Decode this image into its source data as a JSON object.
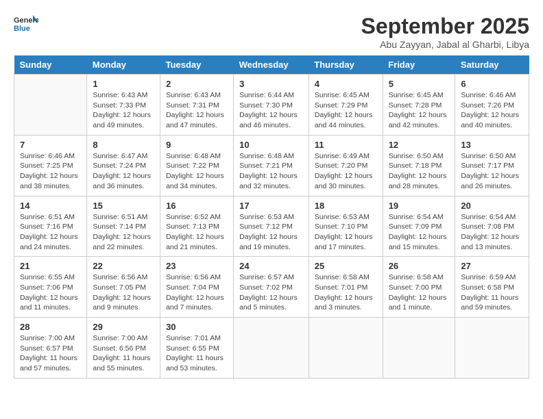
{
  "header": {
    "logo_line1": "General",
    "logo_line2": "Blue",
    "month": "September 2025",
    "location": "Abu Zayyan, Jabal al Gharbi, Libya"
  },
  "days_of_week": [
    "Sunday",
    "Monday",
    "Tuesday",
    "Wednesday",
    "Thursday",
    "Friday",
    "Saturday"
  ],
  "weeks": [
    [
      {
        "day": "",
        "info": ""
      },
      {
        "day": "1",
        "info": "Sunrise: 6:43 AM\nSunset: 7:33 PM\nDaylight: 12 hours\nand 49 minutes."
      },
      {
        "day": "2",
        "info": "Sunrise: 6:43 AM\nSunset: 7:31 PM\nDaylight: 12 hours\nand 47 minutes."
      },
      {
        "day": "3",
        "info": "Sunrise: 6:44 AM\nSunset: 7:30 PM\nDaylight: 12 hours\nand 46 minutes."
      },
      {
        "day": "4",
        "info": "Sunrise: 6:45 AM\nSunset: 7:29 PM\nDaylight: 12 hours\nand 44 minutes."
      },
      {
        "day": "5",
        "info": "Sunrise: 6:45 AM\nSunset: 7:28 PM\nDaylight: 12 hours\nand 42 minutes."
      },
      {
        "day": "6",
        "info": "Sunrise: 6:46 AM\nSunset: 7:26 PM\nDaylight: 12 hours\nand 40 minutes."
      }
    ],
    [
      {
        "day": "7",
        "info": "Sunrise: 6:46 AM\nSunset: 7:25 PM\nDaylight: 12 hours\nand 38 minutes."
      },
      {
        "day": "8",
        "info": "Sunrise: 6:47 AM\nSunset: 7:24 PM\nDaylight: 12 hours\nand 36 minutes."
      },
      {
        "day": "9",
        "info": "Sunrise: 6:48 AM\nSunset: 7:22 PM\nDaylight: 12 hours\nand 34 minutes."
      },
      {
        "day": "10",
        "info": "Sunrise: 6:48 AM\nSunset: 7:21 PM\nDaylight: 12 hours\nand 32 minutes."
      },
      {
        "day": "11",
        "info": "Sunrise: 6:49 AM\nSunset: 7:20 PM\nDaylight: 12 hours\nand 30 minutes."
      },
      {
        "day": "12",
        "info": "Sunrise: 6:50 AM\nSunset: 7:18 PM\nDaylight: 12 hours\nand 28 minutes."
      },
      {
        "day": "13",
        "info": "Sunrise: 6:50 AM\nSunset: 7:17 PM\nDaylight: 12 hours\nand 26 minutes."
      }
    ],
    [
      {
        "day": "14",
        "info": "Sunrise: 6:51 AM\nSunset: 7:16 PM\nDaylight: 12 hours\nand 24 minutes."
      },
      {
        "day": "15",
        "info": "Sunrise: 6:51 AM\nSunset: 7:14 PM\nDaylight: 12 hours\nand 22 minutes."
      },
      {
        "day": "16",
        "info": "Sunrise: 6:52 AM\nSunset: 7:13 PM\nDaylight: 12 hours\nand 21 minutes."
      },
      {
        "day": "17",
        "info": "Sunrise: 6:53 AM\nSunset: 7:12 PM\nDaylight: 12 hours\nand 19 minutes."
      },
      {
        "day": "18",
        "info": "Sunrise: 6:53 AM\nSunset: 7:10 PM\nDaylight: 12 hours\nand 17 minutes."
      },
      {
        "day": "19",
        "info": "Sunrise: 6:54 AM\nSunset: 7:09 PM\nDaylight: 12 hours\nand 15 minutes."
      },
      {
        "day": "20",
        "info": "Sunrise: 6:54 AM\nSunset: 7:08 PM\nDaylight: 12 hours\nand 13 minutes."
      }
    ],
    [
      {
        "day": "21",
        "info": "Sunrise: 6:55 AM\nSunset: 7:06 PM\nDaylight: 12 hours\nand 11 minutes."
      },
      {
        "day": "22",
        "info": "Sunrise: 6:56 AM\nSunset: 7:05 PM\nDaylight: 12 hours\nand 9 minutes."
      },
      {
        "day": "23",
        "info": "Sunrise: 6:56 AM\nSunset: 7:04 PM\nDaylight: 12 hours\nand 7 minutes."
      },
      {
        "day": "24",
        "info": "Sunrise: 6:57 AM\nSunset: 7:02 PM\nDaylight: 12 hours\nand 5 minutes."
      },
      {
        "day": "25",
        "info": "Sunrise: 6:58 AM\nSunset: 7:01 PM\nDaylight: 12 hours\nand 3 minutes."
      },
      {
        "day": "26",
        "info": "Sunrise: 6:58 AM\nSunset: 7:00 PM\nDaylight: 12 hours\nand 1 minute."
      },
      {
        "day": "27",
        "info": "Sunrise: 6:59 AM\nSunset: 6:58 PM\nDaylight: 11 hours\nand 59 minutes."
      }
    ],
    [
      {
        "day": "28",
        "info": "Sunrise: 7:00 AM\nSunset: 6:57 PM\nDaylight: 11 hours\nand 57 minutes."
      },
      {
        "day": "29",
        "info": "Sunrise: 7:00 AM\nSunset: 6:56 PM\nDaylight: 11 hours\nand 55 minutes."
      },
      {
        "day": "30",
        "info": "Sunrise: 7:01 AM\nSunset: 6:55 PM\nDaylight: 11 hours\nand 53 minutes."
      },
      {
        "day": "",
        "info": ""
      },
      {
        "day": "",
        "info": ""
      },
      {
        "day": "",
        "info": ""
      },
      {
        "day": "",
        "info": ""
      }
    ]
  ]
}
